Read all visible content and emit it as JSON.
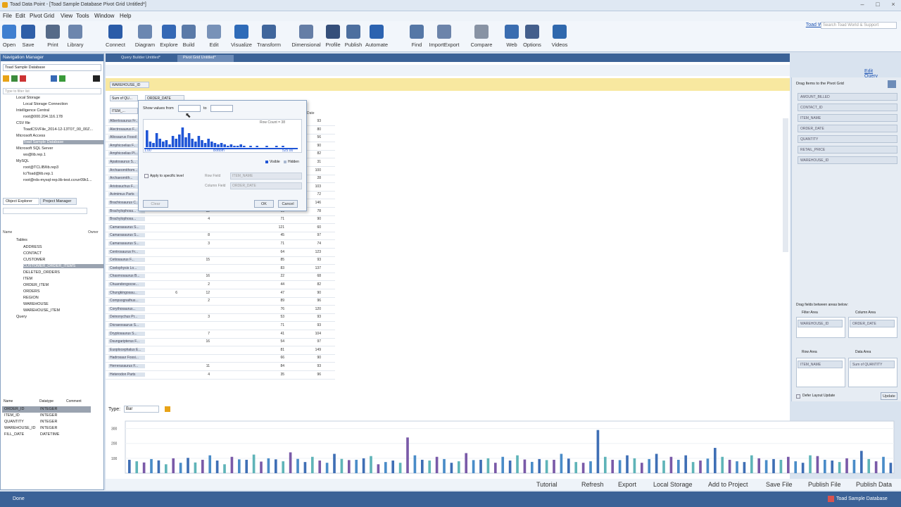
{
  "app": {
    "title": "Toad Data Point - [Toad Sample Database Pivot Grid Untitled*]"
  },
  "menu": [
    "File",
    "Edit",
    "Pivot Grid",
    "View",
    "Tools",
    "Window",
    "Help"
  ],
  "toolbar": {
    "buttons": [
      {
        "label": "Open",
        "icon": "folder-open-icon",
        "color": "#3f7fd0"
      },
      {
        "label": "Save",
        "icon": "save-icon",
        "color": "#2f5fa8"
      },
      {
        "label": "Print",
        "icon": "print-icon",
        "color": "#556a88"
      },
      {
        "label": "Library",
        "icon": "library-icon",
        "color": "#6d86ad"
      },
      {
        "label": "Connect",
        "icon": "connect-icon",
        "color": "#2b5ca8"
      },
      {
        "label": "Diagram",
        "icon": "diagram-icon",
        "color": "#6b87b1"
      },
      {
        "label": "Explore",
        "icon": "explore-icon",
        "color": "#3468b5"
      },
      {
        "label": "Build",
        "icon": "build-icon",
        "color": "#5a7aa8"
      },
      {
        "label": "Edit",
        "icon": "edit-icon",
        "color": "#7892b8"
      },
      {
        "label": "Visualize",
        "icon": "visualize-icon",
        "color": "#2e6bb8"
      },
      {
        "label": "Transform",
        "icon": "transform-icon",
        "color": "#40669c"
      },
      {
        "label": "Dimensional",
        "icon": "dimensional-icon",
        "color": "#657ea6"
      },
      {
        "label": "Profile",
        "icon": "profile-icon",
        "color": "#354f7a"
      },
      {
        "label": "Publish",
        "icon": "publish-icon",
        "color": "#4d6f9f"
      },
      {
        "label": "Automate",
        "icon": "automate-icon",
        "color": "#2c63b0"
      },
      {
        "label": "Find",
        "icon": "find-icon",
        "color": "#5577a6"
      },
      {
        "label": "ImportExport",
        "icon": "import-export-icon",
        "color": "#6c84aa"
      },
      {
        "label": "Compare",
        "icon": "compare-icon",
        "color": "#8893a4"
      },
      {
        "label": "Web",
        "icon": "web-icon",
        "color": "#3a6db0"
      },
      {
        "label": "Options",
        "icon": "options-icon",
        "color": "#445f8c"
      },
      {
        "label": "Videos",
        "icon": "videos-icon",
        "color": "#2f68ad"
      }
    ],
    "toad_world": "Toad World",
    "search_placeholder": "Search Toad World & Support"
  },
  "nav": {
    "title": "Navigation Manager",
    "db": "Toad Sample Database",
    "filter_placeholder": "Type to filter list",
    "tree": [
      "Local Storage",
      "Local Storage Connection",
      "Intelligence Central",
      "root@000.204.116.178",
      "CSV file",
      "ToadCSVFile_2014-12-13T07_00_00Z...",
      "Microsoft Access",
      "Toad Sample Database",
      "Microsoft SQL Server",
      "ws@lib.rep.1",
      "MySQL",
      "root@TCLIB/lib.rep3",
      "lc/Toad@lib.rep.1",
      "root@rds-mysql-rep.lib-test.ccnzr09k1..."
    ],
    "tabs": [
      "Object Explorer",
      "Project Manager"
    ],
    "cols": [
      "Name",
      "Owner"
    ],
    "tables": [
      "Tables",
      "ADDRESS",
      "CONTACT",
      "CUSTOMER",
      "CUSTOMER_ORDER_ITEMS",
      "DELETED_ORDERS",
      "ITEM",
      "ORDER_ITEM",
      "ORDERS",
      "REGION",
      "WAREHOUSE",
      "WAREHOUSE_ITEM",
      "Query"
    ],
    "grid_cols": [
      "Name",
      "Datatype",
      "Comment"
    ],
    "grid": [
      [
        "ORDER_ID",
        "INTEGER"
      ],
      [
        "ITEM_ID",
        "INTEGER"
      ],
      [
        "QUANTITY",
        "INTEGER"
      ],
      [
        "WAREHOUSE_ID",
        "INTEGER"
      ],
      [
        "FILL_DATE",
        "DATETIME"
      ]
    ]
  },
  "doc_tabs": [
    "Query Builder Untitled*",
    "Pivot Grid Untitled*"
  ],
  "edit_query": "Edit Query",
  "pivot": {
    "filter_field": "WAREHOUSE_ID",
    "data_field": "Sum of QU...",
    "col_field": "ORDER_DATE",
    "row_field": "ITEM_...",
    "col_header": "Date",
    "rows": [
      [
        "Albertosaurus Fr...",
        "",
        "",
        "",
        "",
        "93"
      ],
      [
        "Alectrosaurus F...",
        "",
        "",
        "",
        "",
        "80"
      ],
      [
        "Allosaurus Fossil",
        "",
        "",
        "",
        "",
        "56"
      ],
      [
        "Amphicoelias F...",
        "",
        "",
        "",
        "",
        "90"
      ],
      [
        "Amphicoelias Pl...",
        "",
        "",
        "",
        "",
        "82"
      ],
      [
        "Apatosaurus S...",
        "",
        "",
        "",
        "",
        "31"
      ],
      [
        "Archaeornithom...",
        "",
        "",
        "",
        "",
        "100"
      ],
      [
        "Archaeornith...",
        "",
        "",
        "",
        "",
        "28"
      ],
      [
        "Aristosuchus F...",
        "",
        "",
        "",
        "",
        "103"
      ],
      [
        "Avimimus Parts",
        "",
        "",
        "",
        "",
        "72"
      ],
      [
        "Brachiosaurus C...",
        "",
        "",
        "",
        "",
        "146"
      ],
      [
        "Brachylophosa...",
        "",
        "12",
        "",
        "69",
        "78"
      ],
      [
        "Brachylophosa...",
        "",
        "4",
        "",
        "71",
        "90"
      ],
      [
        "Camarasaurus S...",
        "",
        "",
        "",
        "121",
        "60"
      ],
      [
        "Camarasaurus S...",
        "",
        "8",
        "",
        "45",
        "97"
      ],
      [
        "Camarasaurus S...",
        "",
        "3",
        "",
        "71",
        "74"
      ],
      [
        "Centrosaurus Fr...",
        "",
        "",
        "",
        "64",
        "123"
      ],
      [
        "Cetiosaurus F...",
        "",
        "15",
        "",
        "85",
        "93"
      ],
      [
        "Coelophysis Lo...",
        "",
        "",
        "",
        "83",
        "137"
      ],
      [
        "Chasmosaurus B...",
        "",
        "16",
        "",
        "22",
        "68"
      ],
      [
        "Chuandongocoe...",
        "",
        "2",
        "",
        "44",
        "82"
      ],
      [
        "Chungkingosau...",
        "6",
        "12",
        "",
        "47",
        "90"
      ],
      [
        "Compsognathus...",
        "",
        "2",
        "",
        "89",
        "96"
      ],
      [
        "Corythosaurus...",
        "",
        "",
        "",
        "76",
        "120"
      ],
      [
        "Deinonychus Pr...",
        "",
        "3",
        "",
        "53",
        "93"
      ],
      [
        "Dicraeosaurus S...",
        "",
        "",
        "",
        "71",
        "93"
      ],
      [
        "Dryptosaurus S...",
        "",
        "7",
        "",
        "41",
        "104"
      ],
      [
        "Dsungaripterus F...",
        "",
        "16",
        "",
        "54",
        "97"
      ],
      [
        "Euoplocephalus E...",
        "",
        "",
        "",
        "81",
        "149"
      ],
      [
        "Hadrosaur Fossi...",
        "",
        "",
        "",
        "66",
        "90"
      ],
      [
        "Herrerasaurus F...",
        "",
        "11",
        "",
        "84",
        "93"
      ],
      [
        "Heterodon Parts",
        "",
        "4",
        "",
        "35",
        "96"
      ]
    ]
  },
  "dialog": {
    "title": "Show values from",
    "to_label": "to",
    "count_label": "Row Count = 38",
    "min": "1.00",
    "max": "525.00",
    "mid": "Bottom",
    "legend_visible": "Visible",
    "legend_hidden": "Hidden",
    "apply_label": "Apply to specific level",
    "row_field_label": "Row Field",
    "row_field_value": "ITEM_NAME",
    "column_field_label": "Column Field",
    "column_field_value": "ORDER_DATE",
    "clear": "Clear",
    "ok": "OK",
    "cancel": "Cancel"
  },
  "right": {
    "title": "Drag Items to the Pivot Grid",
    "fields": [
      "AMOUNT_BILLED",
      "CONTACT_ID",
      "ITEM_NAME",
      "ORDER_DATE",
      "QUANTITY",
      "RETAIL_PRICE",
      "WAREHOUSE_ID"
    ],
    "drag_title": "Drag fields between areas below:",
    "filter_area": "Filter Area",
    "column_area": "Column Area",
    "row_area": "Row Area",
    "data_area": "Data Area",
    "filter_item": "WAREHOUSE_ID",
    "column_item": "ORDER_DATE",
    "row_item": "ITEM_NAME",
    "data_item": "Sum of QUANTITY",
    "defer": "Defer Layout Update",
    "update": "Update"
  },
  "chart_data": {
    "type": "bar",
    "chart_type_label": "Type:",
    "chart_type_value": "Bar",
    "yticks": [
      "300",
      "200",
      "100"
    ],
    "ylim": [
      0,
      350
    ],
    "values": [
      90,
      80,
      72,
      95,
      86,
      60,
      100,
      70,
      103,
      72,
      90,
      120,
      85,
      60,
      110,
      93,
      90,
      125,
      78,
      100,
      93,
      80,
      140,
      96,
      75,
      110,
      85,
      70,
      130,
      96,
      88,
      90,
      100,
      115,
      60,
      75,
      85,
      70,
      240,
      120,
      90,
      85,
      110,
      95,
      70,
      80,
      135,
      88,
      90,
      100,
      70,
      110,
      85,
      120,
      92,
      76,
      95,
      88,
      90,
      130,
      98,
      75,
      70,
      80,
      290,
      110,
      90,
      88,
      120,
      100,
      70,
      95,
      130,
      85,
      110,
      90,
      120,
      75,
      85,
      98,
      170,
      110,
      90,
      80,
      75,
      120,
      100,
      88,
      95,
      90,
      110,
      80,
      70,
      120,
      115,
      90,
      85,
      75,
      100,
      90,
      150,
      95,
      80,
      110,
      70
    ]
  },
  "bottom": [
    "Tutorial",
    "Refresh",
    "Export",
    "Local Storage",
    "Add to Project",
    "Save File",
    "Publish File",
    "Publish Data"
  ],
  "status": {
    "left": "Done",
    "right": "Toad Sample Database"
  }
}
